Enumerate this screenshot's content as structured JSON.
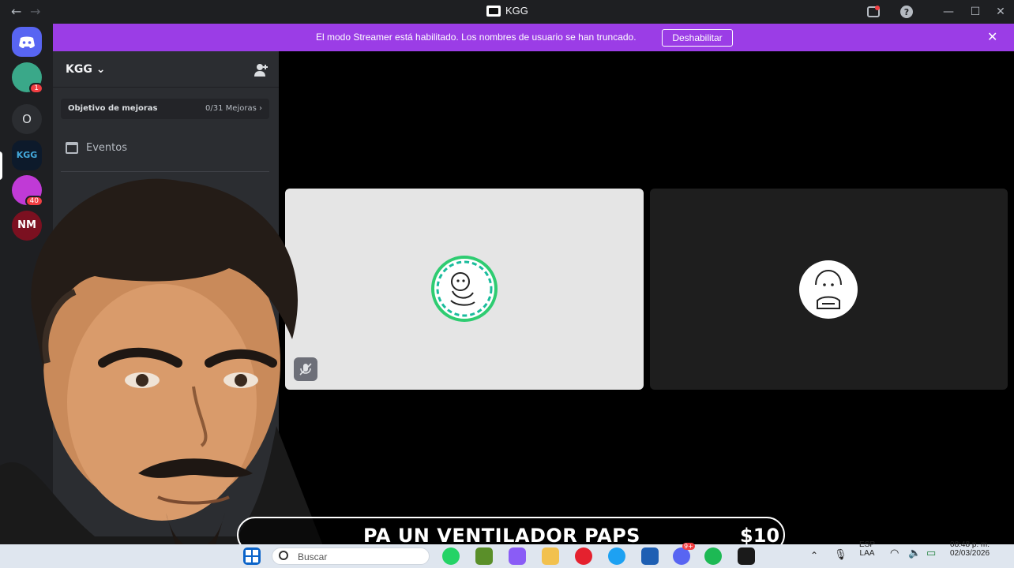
{
  "window": {
    "title": "KGG"
  },
  "banner": {
    "text": "El modo Streamer está habilitado. Los nombres de usuario se han truncado.",
    "button_label": "Deshabilitar"
  },
  "guilds": [
    {
      "name": "direct-messages",
      "badge": ""
    },
    {
      "name": "server-1",
      "badge": "1"
    },
    {
      "name": "server-o",
      "label": "O",
      "badge": ""
    },
    {
      "name": "server-kgg",
      "label": "KGG",
      "badge": ""
    },
    {
      "name": "server-4",
      "badge": "40"
    },
    {
      "name": "server-nm",
      "label": "NM",
      "badge": ""
    }
  ],
  "server": {
    "name": "KGG",
    "boost_label": "Objetivo de mejoras",
    "boost_progress": "0/31 Mejoras",
    "events_label": "Eventos"
  },
  "overlay": {
    "ticker_text": "PA UN VENTILADOR PAPS",
    "ticker_amount": "$10"
  },
  "taskbar": {
    "search_placeholder": "Buscar",
    "language": "ESP",
    "layout": "LAA",
    "time": "08:48 p. m.",
    "date": "02/03/2026",
    "discord_badge": "9+"
  },
  "colors": {
    "banner": "#9b3de6",
    "sidebar": "#2b2d31",
    "guild_bar": "#1e1f22"
  }
}
